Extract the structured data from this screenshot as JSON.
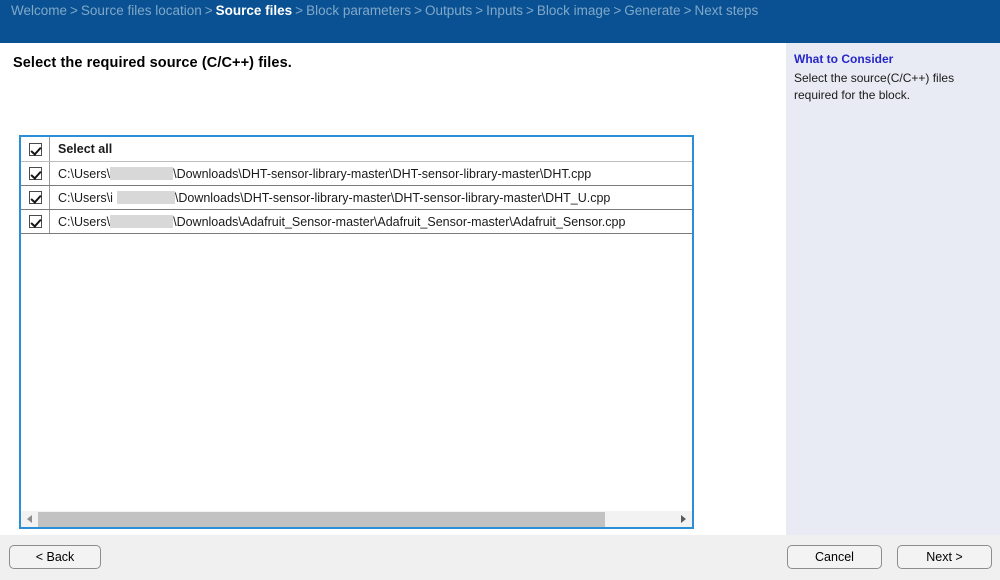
{
  "header": {
    "breadcrumb": [
      {
        "label": "Welcome",
        "current": false
      },
      {
        "label": "Source files location",
        "current": false
      },
      {
        "label": "Source files",
        "current": true
      },
      {
        "label": "Block parameters",
        "current": false
      },
      {
        "label": "Outputs",
        "current": false
      },
      {
        "label": "Inputs",
        "current": false
      },
      {
        "label": "Block image",
        "current": false
      },
      {
        "label": "Generate",
        "current": false
      },
      {
        "label": "Next steps",
        "current": false
      }
    ],
    "separator": ">",
    "background_color": "#0a5193",
    "inactive_color": "#7fa8c9",
    "active_color": "#ffffff"
  },
  "main": {
    "page_title": "Select the required source (C/C++) files.",
    "select_all_label": "Select all",
    "select_all_checked": true,
    "files": [
      {
        "prefix": "C:\\Users\\",
        "suffix": "\\Downloads\\DHT-sensor-library-master\\DHT-sensor-library-master\\DHT.cpp",
        "checked": true
      },
      {
        "prefix": "C:\\Users\\i",
        "suffix": "\\Downloads\\DHT-sensor-library-master\\DHT-sensor-library-master\\DHT_U.cpp",
        "checked": true
      },
      {
        "prefix": "C:\\Users\\",
        "suffix": "\\Downloads\\Adafruit_Sensor-master\\Adafruit_Sensor-master\\Adafruit_Sensor.cpp",
        "checked": true
      }
    ],
    "listbox_border_color": "#2c8ed4",
    "scrollbar": {
      "left_arrow": "scroll-left-arrow",
      "right_arrow": "scroll-right-arrow",
      "thumb_fraction_percent": 89
    }
  },
  "sidebar": {
    "title": "What to Consider",
    "body": "Select the source(C/C++) files required for the block.",
    "background_color": "#e8ebf3",
    "title_color": "#2626c8"
  },
  "footer": {
    "back_label": "< Back",
    "cancel_label": "Cancel",
    "next_label": "Next >",
    "background_color": "#f0f0f0"
  }
}
